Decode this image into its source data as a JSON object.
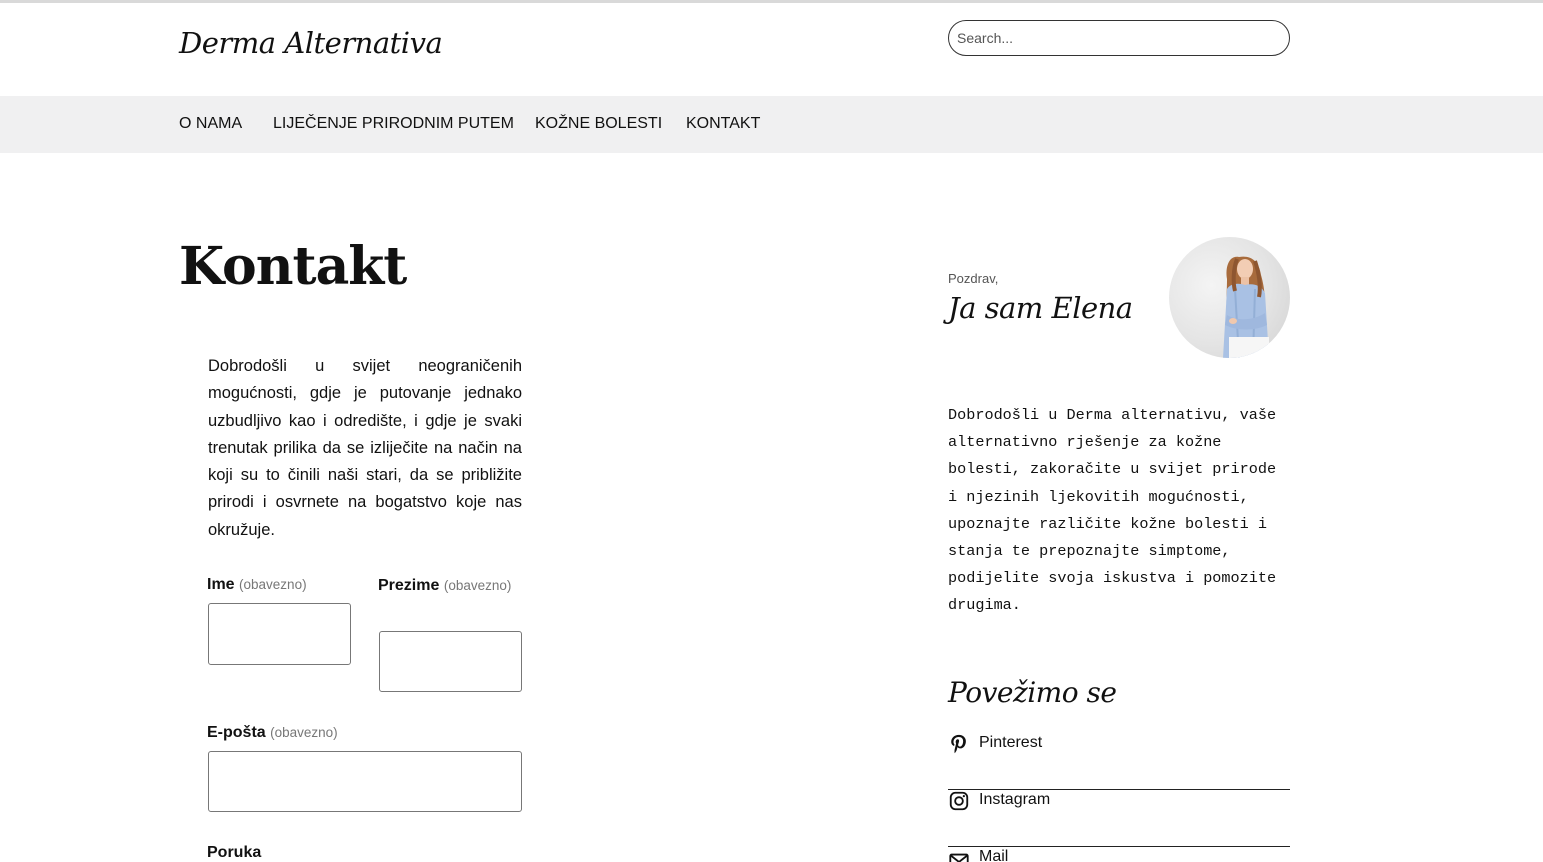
{
  "site": {
    "title": "Derma Alternativa"
  },
  "search": {
    "placeholder": "Search..."
  },
  "nav": {
    "items": [
      {
        "label": "O NAMA"
      },
      {
        "label": "LIJEČENJE PRIRODNIM PUTEM"
      },
      {
        "label": "KOŽNE BOLESTI"
      },
      {
        "label": "KONTAKT"
      }
    ]
  },
  "main": {
    "title": "Kontakt",
    "intro": "Dobrodošli u svijet neograničenih mogućnosti, gdje je putovanje jednako uzbudljivo kao i odredište, i gdje je svaki trenutak prilika da se izliječite na način na koji su to činili naši stari, da se približite prirodi i osvrnete na bogatstvo koje nas okružuje."
  },
  "form": {
    "required_note": "(obavezno)",
    "first_name_label": "Ime",
    "last_name_label": "Prezime",
    "email_label": "E-pošta",
    "message_label": "Poruka"
  },
  "sidebar": {
    "greeting_small": "Pozdrav,",
    "greeting_name": "Ja sam Elena",
    "bio": "Dobrodošli u Derma alternativu, vaše alternativno rješenje za kožne bolesti, zakoračite u svijet prirode i njezinih ljekovitih mogućnosti, upoznajte različite kožne bolesti i stanja te prepoznajte simptome, podijelite svoja iskustva i pomozite drugima.",
    "connect_title": "Povežimo se",
    "social": [
      {
        "label": "Pinterest",
        "icon": "pinterest-icon"
      },
      {
        "label": "Instagram",
        "icon": "instagram-icon"
      },
      {
        "label": "Mail",
        "icon": "mail-icon"
      }
    ]
  }
}
